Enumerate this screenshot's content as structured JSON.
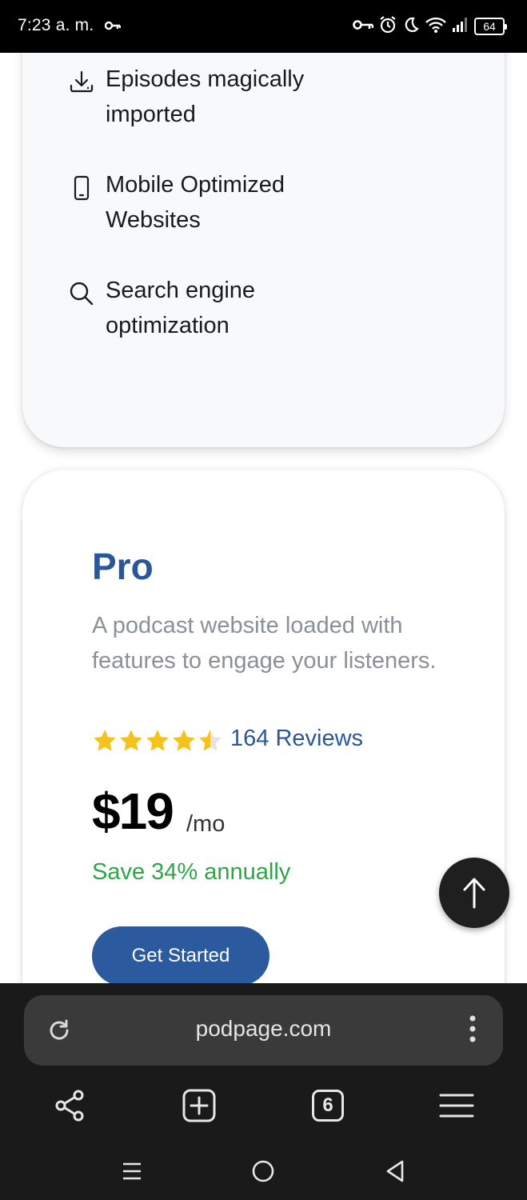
{
  "status_bar": {
    "time": "7:23 a. m.",
    "battery": "64",
    "icons": [
      "vpn-key-icon",
      "alarm-icon",
      "do-not-disturb-moon-icon",
      "wifi-icon",
      "signal-icon",
      "battery-icon"
    ]
  },
  "features": [
    {
      "icon": "download-icon",
      "text": "Episodes magically imported"
    },
    {
      "icon": "mobile-phone-icon",
      "text": "Mobile Optimized Websites"
    },
    {
      "icon": "search-icon",
      "text": "Search engine optimization"
    }
  ],
  "pro_plan": {
    "title": "Pro",
    "description": "A podcast website loaded with features to engage your listeners.",
    "rating": 4.5,
    "rating_max": 5,
    "reviews": "164 Reviews",
    "price": "$19",
    "period": "/mo",
    "savings": "Save 34% annually",
    "cta": "Get Started"
  },
  "browser": {
    "url": "podpage.com",
    "open_tabs": "6"
  },
  "colors": {
    "accent_blue": "#2b579a",
    "button_blue": "#2b5b9e",
    "savings_green": "#2fa646",
    "star_yellow": "#f7c21b"
  }
}
